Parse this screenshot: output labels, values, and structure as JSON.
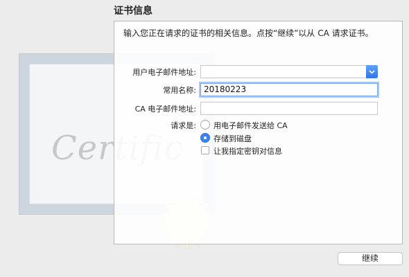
{
  "section_title": "证书信息",
  "description": "输入您正在请求的证书的相关信息。点按“继续”以从 CA 请求证书。",
  "illustration": {
    "script_text": "Certific"
  },
  "form": {
    "email_label": "用户电子邮件地址:",
    "email_value": "",
    "common_name_label": "常用名称:",
    "common_name_value": "20180223",
    "ca_email_label": "CA 电子邮件地址:",
    "ca_email_value": "",
    "request_label": "请求是:",
    "options": [
      {
        "label": "用电子邮件发送给 CA",
        "selected": false
      },
      {
        "label": "存储到磁盘",
        "selected": true
      }
    ],
    "checkbox_label": "让我指定密钥对信息",
    "checkbox_checked": false
  },
  "continue_button": "继续",
  "colors": {
    "accent": "#3b82f2",
    "focus_ring": "#a9c8f3"
  }
}
